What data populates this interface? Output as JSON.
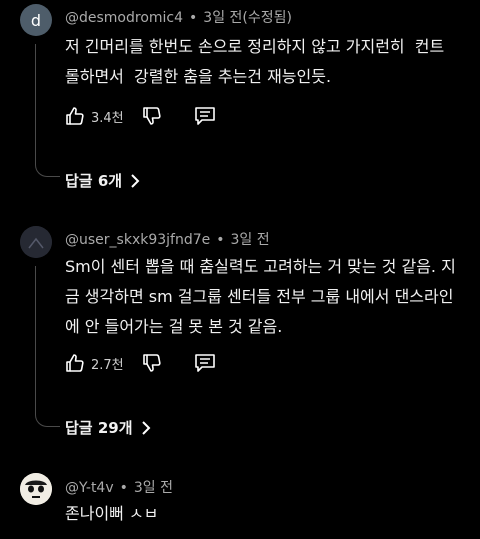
{
  "comments": [
    {
      "avatar_letter": "d",
      "author": "@desmodromic4",
      "time": "3일 전(수정됨)",
      "lines": [
        "저 긴머리를 한번도 손으로 정리하지 않고 가지런히  컨트",
        "롤하면서  강렬한 춤을 추는건 재능인듯."
      ],
      "likes": "3.4천",
      "replies": "답글 6개"
    },
    {
      "author": "@user_skxk93jfnd7e",
      "time": "3일 전",
      "lines": [
        "Sm이 센터 뽑을 때 춤실력도 고려하는 거 맞는 것 같음. 지",
        "금 생각하면 sm 걸그룹 센터들 전부 그룹 내에서 댄스라인",
        "에 안 들어가는 걸 못 본 것 같음."
      ],
      "likes": "2.7천",
      "replies": "답글 29개"
    },
    {
      "author": "@Y-t4v",
      "time": "3일 전",
      "lines": [
        "존나이뻐 ㅅㅂ"
      ]
    }
  ],
  "icons": {
    "like": "thumbs-up-icon",
    "dislike": "thumbs-down-icon",
    "reply": "reply-comment-icon",
    "more": "chevron-right-icon"
  },
  "colors": {
    "background": "#000000",
    "meta": "#aaaaaa",
    "text": "#f1f1f1",
    "avatar_d": "#4e5d6a"
  }
}
